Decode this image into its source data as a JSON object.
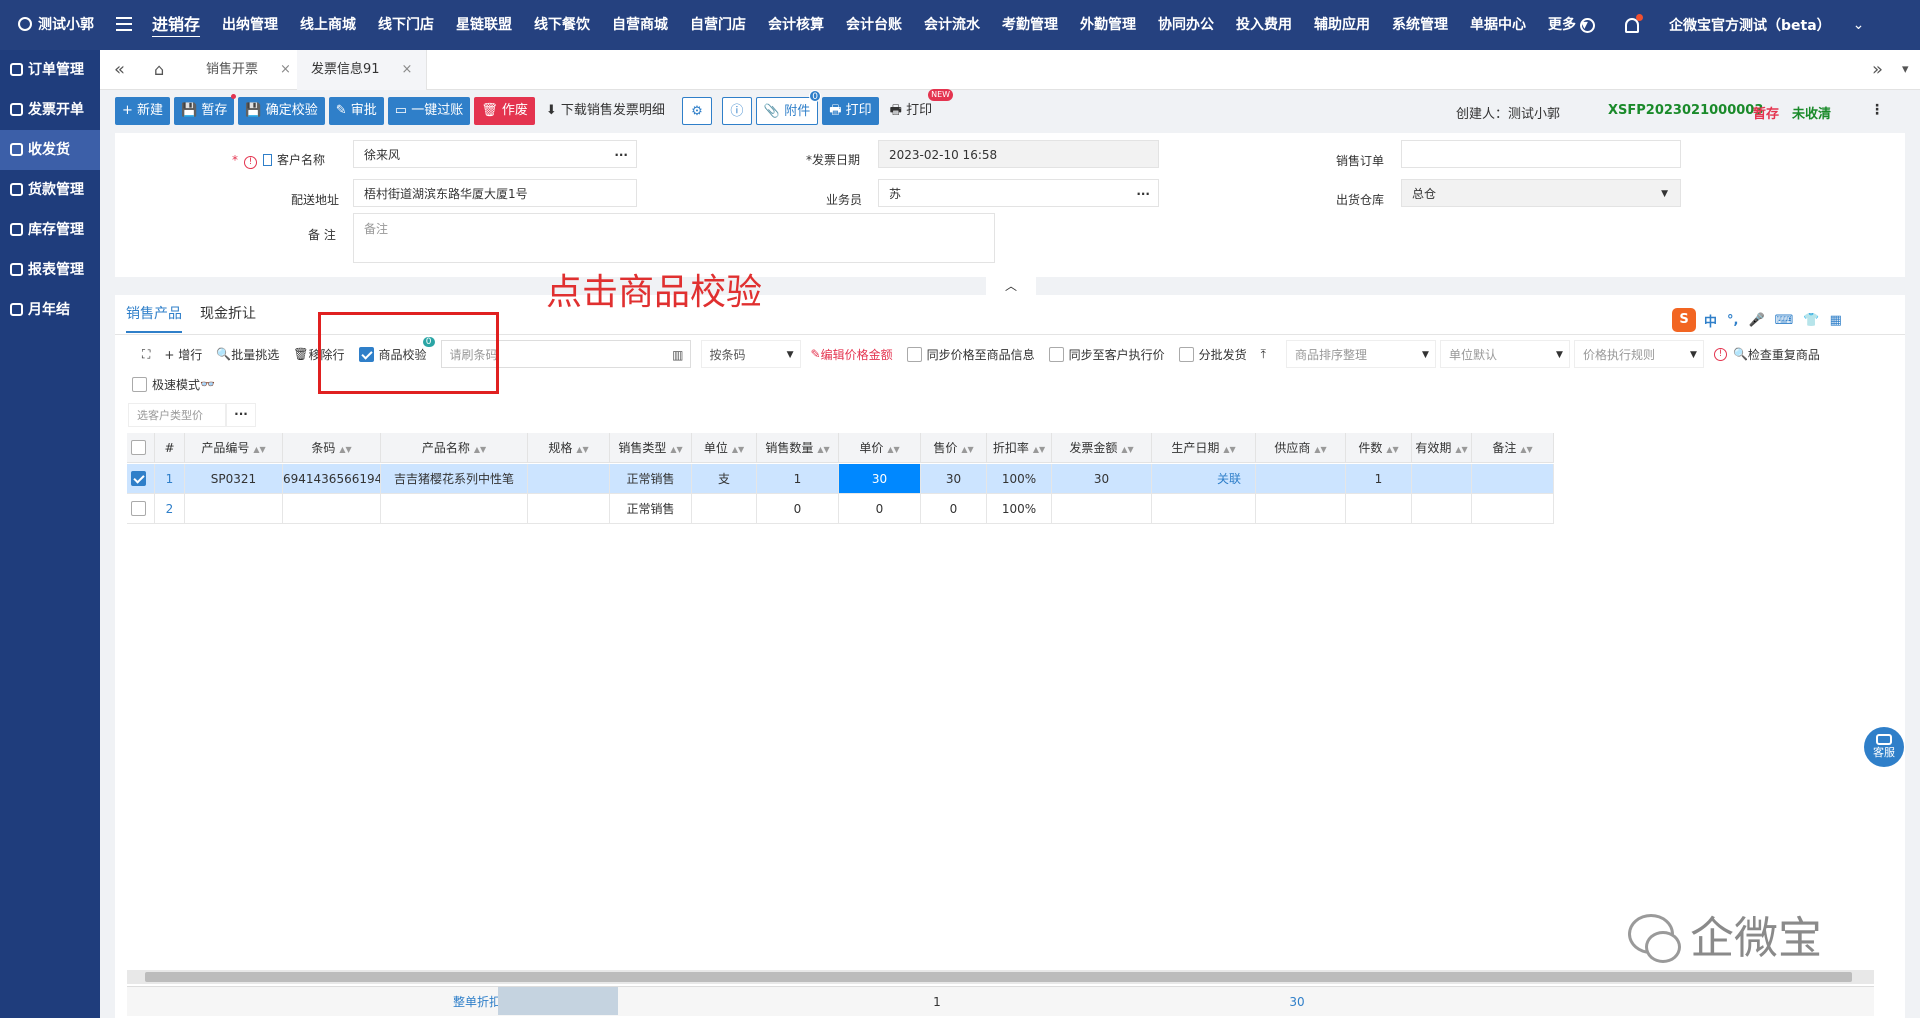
{
  "topbar": {
    "user": "测试小郭",
    "nav": [
      "进销存",
      "出纳管理",
      "线上商城",
      "线下门店",
      "星链联盟",
      "线下餐饮",
      "自营商城",
      "自营门店",
      "会计核算",
      "会计台账",
      "会计流水",
      "考勤管理",
      "外勤管理",
      "协同办公",
      "投入费用",
      "辅助应用",
      "系统管理",
      "单据中心",
      "更多 ▾"
    ],
    "active_nav": "进销存",
    "company": "企微宝官方测试（beta）"
  },
  "sidebar": {
    "items": [
      "订单管理",
      "发票开单",
      "收发货",
      "货款管理",
      "库存管理",
      "报表管理",
      "月年结"
    ],
    "active": "收发货"
  },
  "tabs": {
    "items": [
      "销售开票",
      "发票信息91"
    ],
    "close": "×"
  },
  "toolbar": {
    "new": "+ 新建",
    "save_draft": "暂存",
    "confirm_check": "确定校验",
    "approve": "审批",
    "post": "一键过账",
    "void": "作废",
    "download": "下载销售发票明细",
    "attachment": "附件",
    "attachment_count": "0",
    "print": "打印",
    "print2": "打印",
    "new_badge": "NEW",
    "creator": "创建人：测试小郭",
    "doc_no": "XSFP2023021000003",
    "status_draft": "暂存",
    "status_unpaid": "未收清"
  },
  "form": {
    "customer_label": "客户名称",
    "customer_value": "徐来风",
    "invoice_date_label": "*发票日期",
    "invoice_date_value": "2023-02-10 16:58",
    "sales_order_label": "销售订单",
    "address_label": "配送地址",
    "address_value": "梧村街道湖滨东路华厦大厦1号",
    "salesman_label": "业务员",
    "salesman_value": "苏",
    "warehouse_label": "出货仓库",
    "warehouse_value": "总仓",
    "remark_label": "备  注",
    "remark_placeholder": "备注"
  },
  "annotation": "点击商品校验",
  "subtabs": [
    "销售产品",
    "现金折让"
  ],
  "ime": [
    "中",
    "°,",
    "🎤",
    "⌨",
    "👕",
    "▦"
  ],
  "grid_toolbar": {
    "fullscreen": "⛶",
    "add_row": "+ 增行",
    "batch_pick": "批量挑选",
    "remove_row": "移除行",
    "product_check": "商品校验",
    "product_check_badge": "0",
    "scan_placeholder": "请刷条码",
    "by_barcode": "按条码",
    "edit_price": "编辑价格金额",
    "sync_price_product": "同步价格至商品信息",
    "sync_price_customer": "同步至客户执行价",
    "batch_ship": "分批发货",
    "sort_placeholder": "商品排序整理",
    "unit_default": "单位默认",
    "price_rule": "价格执行规则",
    "check_dup": "检查重复商品",
    "fast_mode": "极速模式",
    "customer_type_placeholder": "选客户类型价"
  },
  "table": {
    "columns": [
      "#",
      "产品编号",
      "条码",
      "产品名称",
      "规格",
      "销售类型",
      "单位",
      "销售数量",
      "单价",
      "售价",
      "折扣率",
      "发票金额",
      "生产日期",
      "供应商",
      "件数",
      "有效期",
      "备注"
    ],
    "rows": [
      {
        "n": "1",
        "code": "SP0321",
        "barcode": "6941436566194",
        "name": "吉吉猪樱花系列中性笔",
        "spec": "",
        "type": "正常销售",
        "unit": "支",
        "qty": "1",
        "price": "30",
        "sale": "30",
        "disc": "100%",
        "amount": "30",
        "date": "关联",
        "supplier": "",
        "pieces": "1",
        "expiry": "",
        "remark": ""
      },
      {
        "n": "2",
        "code": "",
        "barcode": "",
        "name": "",
        "spec": "",
        "type": "正常销售",
        "unit": "",
        "qty": "0",
        "price": "0",
        "sale": "0",
        "disc": "100%",
        "amount": "",
        "date": "",
        "supplier": "",
        "pieces": "",
        "expiry": "",
        "remark": ""
      }
    ],
    "footer": {
      "label": "整单折扣",
      "qty": "1",
      "amount": "30"
    }
  },
  "service": "客服",
  "watermark": "企微宝"
}
